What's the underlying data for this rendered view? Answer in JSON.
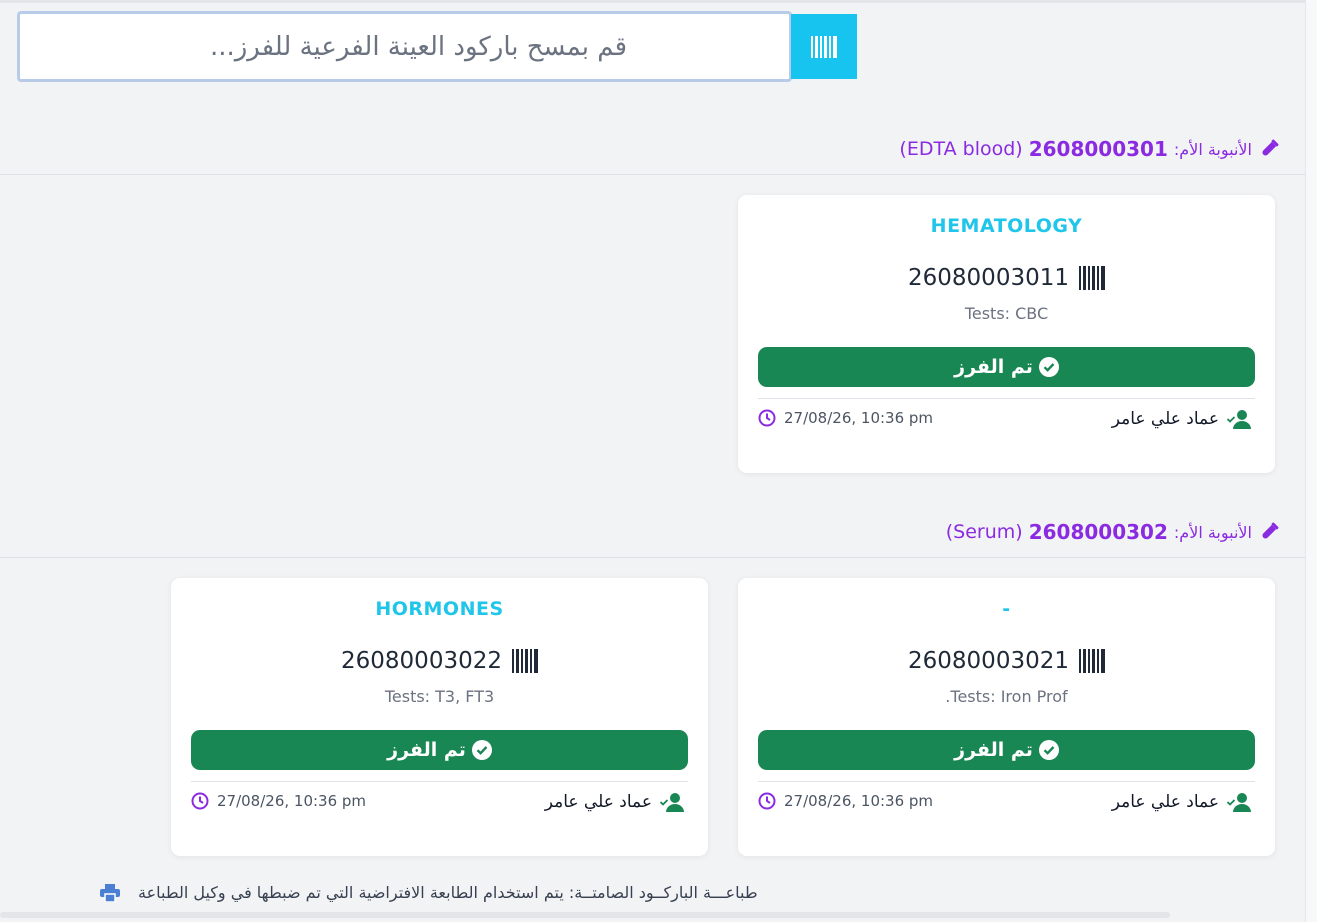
{
  "search": {
    "placeholder": "قم بمسح باركود العينة الفرعية للفرز..."
  },
  "colors": {
    "accent": "#17c3ef",
    "purple": "#8a2be2",
    "success": "#198754",
    "department": "#1fc6ea"
  },
  "groups": [
    {
      "label": "الأنبوبة الأم:",
      "code": "2608000301",
      "type": "(EDTA blood)",
      "cards": [
        {
          "department": "HEMATOLOGY",
          "barcode": "26080003011",
          "tests": "Tests: CBC",
          "status": "تم الفرز",
          "user": "عماد علي عامر",
          "time": "27/08/26, 10:36 pm"
        }
      ]
    },
    {
      "label": "الأنبوبة الأم:",
      "code": "2608000302",
      "type": "(Serum)",
      "cards": [
        {
          "department": "-",
          "barcode": "26080003021",
          "tests": ".Tests: Iron Prof",
          "status": "تم الفرز",
          "user": "عماد علي عامر",
          "time": "27/08/26, 10:36 pm"
        },
        {
          "department": "HORMONES",
          "barcode": "26080003022",
          "tests": "Tests: T3, FT3",
          "status": "تم الفرز",
          "user": "عماد علي عامر",
          "time": "27/08/26, 10:36 pm"
        }
      ]
    }
  ],
  "footer": {
    "print_note": "طباعـــة الباركــود الصامتــة: يتم استخدام الطابعة الافتراضية التي تم ضبطها في وكيل الطباعة"
  }
}
